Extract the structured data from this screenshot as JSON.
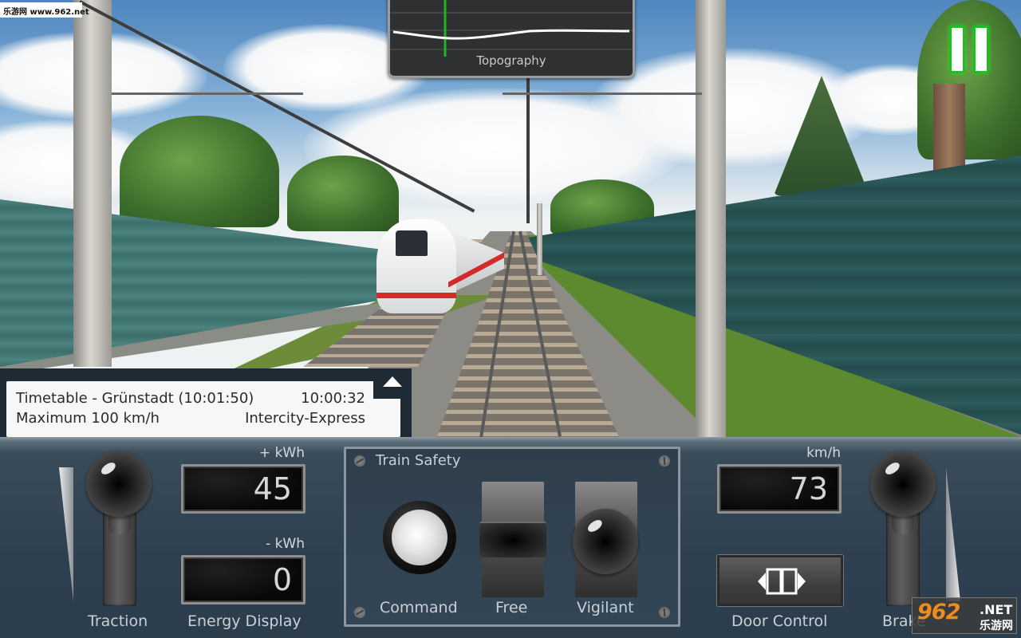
{
  "watermark": {
    "top_text": "乐游网 www.962.net",
    "bottom_number": "962",
    "bottom_net": ".NET",
    "bottom_cn": "乐游网"
  },
  "topography": {
    "title": "Topography",
    "position_marker_color": "#1fb51f",
    "profile_color": "#ffffff"
  },
  "pause_button": {
    "icon": "pause-icon",
    "accent_color": "#19c21d"
  },
  "timetable": {
    "line1_left": "Timetable - Grünstadt (10:01:50)",
    "line1_right": "10:00:32",
    "line2_left": "Maximum 100 km/h",
    "line2_right": "Intercity-Express",
    "toggle_icon": "collapse-up-triangle-icon"
  },
  "dashboard": {
    "traction": {
      "label": "Traction"
    },
    "energy": {
      "plus_unit": "+ kWh",
      "plus_value": "45",
      "minus_unit": "- kWh",
      "minus_value": "0",
      "label": "Energy Display"
    },
    "train_safety": {
      "title": "Train Safety",
      "command_label": "Command",
      "free_label": "Free",
      "vigilant_label": "Vigilant"
    },
    "speed": {
      "unit": "km/h",
      "value": "73"
    },
    "door_control": {
      "label": "Door Control",
      "icon": "door-open-arrows-icon"
    },
    "brake": {
      "label": "Brake"
    }
  }
}
